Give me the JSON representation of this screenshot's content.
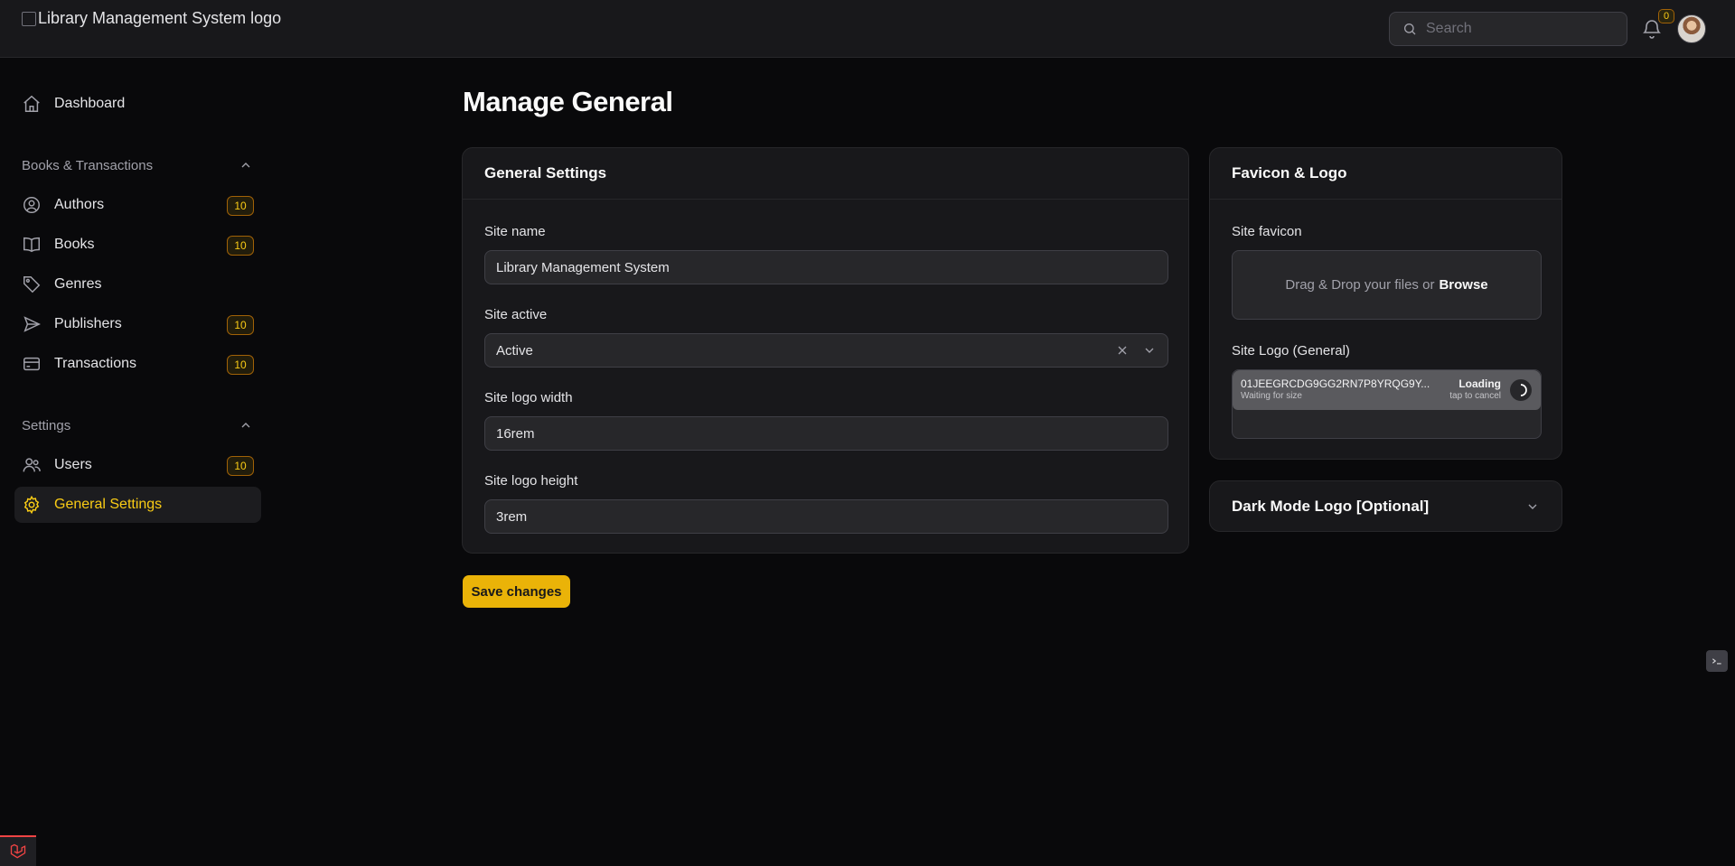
{
  "header": {
    "logo_alt": "Library Management System logo",
    "search_placeholder": "Search",
    "notifications_count": "0"
  },
  "sidebar": {
    "dashboard": "Dashboard",
    "groups": [
      {
        "label": "Books & Transactions",
        "items": [
          {
            "label": "Authors",
            "badge": "10",
            "icon": "user-circle-icon"
          },
          {
            "label": "Books",
            "badge": "10",
            "icon": "book-open-icon"
          },
          {
            "label": "Genres",
            "badge": "",
            "icon": "tag-icon"
          },
          {
            "label": "Publishers",
            "badge": "10",
            "icon": "paper-plane-icon"
          },
          {
            "label": "Transactions",
            "badge": "10",
            "icon": "credit-card-icon"
          }
        ]
      },
      {
        "label": "Settings",
        "items": [
          {
            "label": "Users",
            "badge": "10",
            "icon": "users-icon"
          },
          {
            "label": "General Settings",
            "badge": "",
            "icon": "gear-icon",
            "active": true
          }
        ]
      }
    ]
  },
  "page": {
    "title": "Manage General"
  },
  "general_settings": {
    "heading": "General Settings",
    "site_name_label": "Site name",
    "site_name_value": "Library Management System",
    "site_active_label": "Site active",
    "site_active_value": "Active",
    "logo_width_label": "Site logo width",
    "logo_width_value": "16rem",
    "logo_height_label": "Site logo height",
    "logo_height_value": "3rem"
  },
  "favicon_logo": {
    "heading": "Favicon & Logo",
    "favicon_label": "Site favicon",
    "dropzone_text": "Drag & Drop your files or",
    "dropzone_browse": "Browse",
    "logo_label": "Site Logo (General)",
    "upload": {
      "filename": "01JEEGRCDG9GG2RN7P8YRQG9Y...",
      "sub": "Waiting for size",
      "status": "Loading",
      "cancel": "tap to cancel"
    }
  },
  "dark_mode_logo": {
    "heading": "Dark Mode Logo [Optional]"
  },
  "actions": {
    "save": "Save changes"
  },
  "colors": {
    "accent": "#eab308",
    "background": "#09090b",
    "card": "#18181b"
  }
}
